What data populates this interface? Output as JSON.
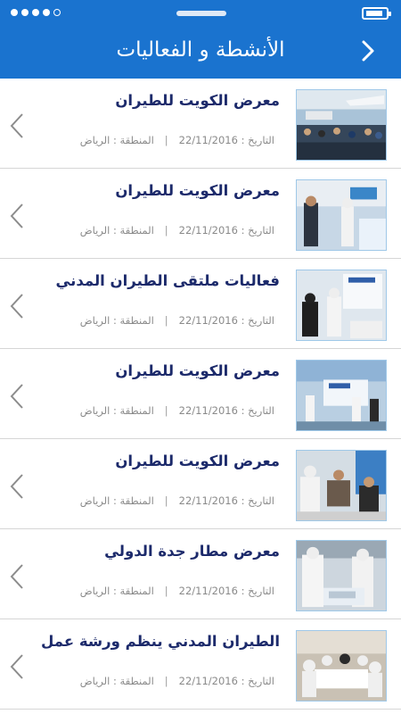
{
  "header": {
    "title": "الأنشطة و الفعاليات",
    "back_icon": "chevron-right-icon",
    "background": "#1a73cf"
  },
  "events": [
    {
      "title": "معرض الكويت للطيران",
      "date": "التاريخ : 22/11/2016",
      "region": "المنطقة : الرياض",
      "image": "exhibition-hall-photo"
    },
    {
      "title": "معرض الكويت للطيران",
      "date": "التاريخ : 22/11/2016",
      "region": "المنطقة : الرياض",
      "image": "booth-visitors-photo"
    },
    {
      "title": "فعاليات ملتقى الطيران المدني",
      "date": "التاريخ : 22/11/2016",
      "region": "المنطقة : الرياض",
      "image": "gaca-booth-photo"
    },
    {
      "title": "معرض الكويت للطيران",
      "date": "التاريخ : 22/11/2016",
      "region": "المنطقة : الرياض",
      "image": "gaca-stand-photo"
    },
    {
      "title": "معرض الكويت للطيران",
      "date": "التاريخ : 22/11/2016",
      "region": "المنطقة : الرياض",
      "image": "meeting-photo"
    },
    {
      "title": "معرض مطار جدة الدولي",
      "date": "التاريخ : 22/11/2016",
      "region": "المنطقة : الرياض",
      "image": "model-display-photo"
    },
    {
      "title": "الطيران المدني ينظم ورشة عمل",
      "date": "التاريخ : 22/11/2016",
      "region": "المنطقة : الرياض",
      "image": "workshop-photo"
    }
  ]
}
